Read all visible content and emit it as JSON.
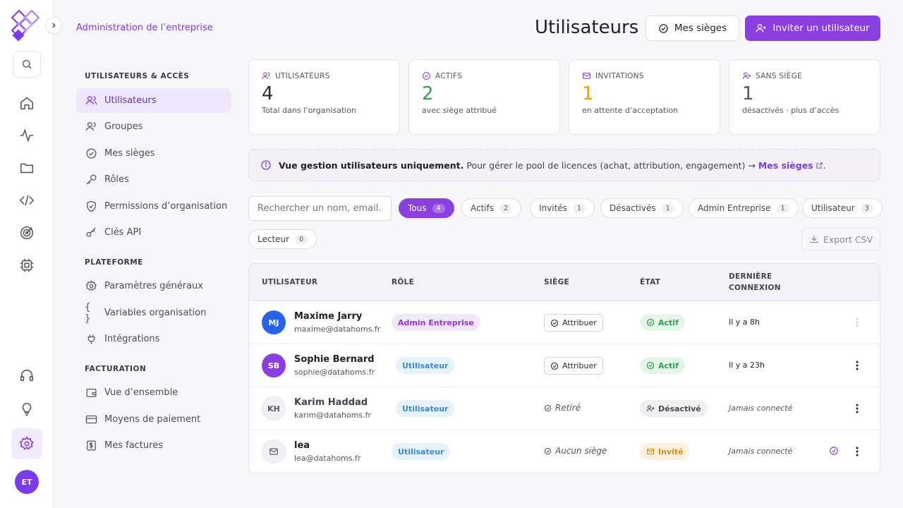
{
  "app": {
    "breadcrumb": "Administration de l’entreprise",
    "page_title": "Utilisateurs",
    "user_initials": "ET"
  },
  "rail": {
    "icons": [
      "search-icon",
      "home-icon",
      "activity-icon",
      "folder-icon",
      "code-icon",
      "target-icon",
      "chip-icon",
      "headphones-icon",
      "lightbulb-icon",
      "settings-icon"
    ]
  },
  "sidebar": {
    "sections": [
      {
        "title": "UTILISATEURS & ACCÈS",
        "items": [
          {
            "label": "Utilisateurs",
            "icon": "users-icon",
            "active": true
          },
          {
            "label": "Groupes",
            "icon": "group-icon"
          },
          {
            "label": "Mes sièges",
            "icon": "check-circle-icon"
          },
          {
            "label": "Rôles",
            "icon": "key-icon"
          },
          {
            "label": "Permissions d’organisation",
            "icon": "shield-icon"
          },
          {
            "label": "Clés API",
            "icon": "api-key-icon"
          }
        ]
      },
      {
        "title": "PLATEFORME",
        "items": [
          {
            "label": "Paramètres généraux",
            "icon": "gear-icon"
          },
          {
            "label": "Variables organisation",
            "icon": "braces-icon"
          },
          {
            "label": "Intégrations",
            "icon": "plug-icon"
          }
        ]
      },
      {
        "title": "FACTURATION",
        "items": [
          {
            "label": "Vue d’ensemble",
            "icon": "wallet-icon"
          },
          {
            "label": "Moyens de paiement",
            "icon": "credit-card-icon"
          },
          {
            "label": "Mes factures",
            "icon": "invoice-icon"
          }
        ]
      }
    ]
  },
  "header": {
    "seats_button": "Mes sièges",
    "invite_button": "Inviter un utilisateur"
  },
  "stats": [
    {
      "label": "UTILISATEURS",
      "value": "4",
      "sub": "Total dans l’organisation",
      "color": "#2b2b33",
      "icon": "users-icon",
      "icon_color": "#8b3fe0"
    },
    {
      "label": "ACTIFS",
      "value": "2",
      "sub": "avec siège attribué",
      "color": "#2f9e4f",
      "icon": "check-circle-icon",
      "icon_color": "#8b3fe0"
    },
    {
      "label": "INVITATIONS",
      "value": "1",
      "sub": "en attente d’acceptation",
      "color": "#f59e0b",
      "icon": "mail-icon",
      "icon_color": "#8b3fe0"
    },
    {
      "label": "SANS SIÈGE",
      "value": "1",
      "sub": "désactivés · plus d’accès",
      "color": "#55555f",
      "icon": "user-x-icon",
      "icon_color": "#8b3fe0"
    }
  ],
  "banner": {
    "bold": "Vue gestion utilisateurs uniquement.",
    "text": "Pour gérer le pool de licences (achat, attribution, engagement) →",
    "link": "Mes sièges",
    "tail": "."
  },
  "search": {
    "placeholder": "Rechercher un nom, email..."
  },
  "filters": [
    {
      "label": "Tous",
      "count": "4",
      "active": true
    },
    {
      "label": "Actifs",
      "count": "2"
    },
    {
      "label": "Invités",
      "count": "1"
    },
    {
      "label": "Désactivés",
      "count": "1"
    },
    {
      "label": "Admin Entreprise",
      "count": "1"
    },
    {
      "label": "Utilisateur",
      "count": "3"
    },
    {
      "label": "Lecteur",
      "count": "0"
    }
  ],
  "export_label": "Export CSV",
  "table": {
    "headers": {
      "user": "UTILISATEUR",
      "role": "RÔLE",
      "seat": "SIÈGE",
      "state": "ÉTAT",
      "last_1": "DERNIÈRE",
      "last_2": "CONNEXION"
    },
    "rows": [
      {
        "initials": "MJ",
        "name": "Maxime Jarry",
        "email": "maxime@datahoms.fr",
        "role": "Admin Entreprise",
        "role_type": "admin",
        "seat": "Attribuer",
        "seat_type": "button",
        "state": "Actif",
        "state_type": "active",
        "last": "Il y a 8h",
        "avatar_bg": "#2563eb",
        "avatar_fg": "#ffffff"
      },
      {
        "initials": "SB",
        "name": "Sophie Bernard",
        "email": "sophie@datahoms.fr",
        "role": "Utilisateur",
        "role_type": "user",
        "seat": "Attribuer",
        "seat_type": "button",
        "state": "Actif",
        "state_type": "active",
        "last": "Il y a 23h",
        "avatar_bg": "#8b3fe0",
        "avatar_fg": "#ffffff"
      },
      {
        "initials": "KH",
        "name": "Karim Haddad",
        "email": "karim@datahoms.fr",
        "role": "Utilisateur",
        "role_type": "user",
        "seat": "Retiré",
        "seat_type": "text",
        "state": "Désactivé",
        "state_type": "off",
        "last": "Jamais connecté",
        "avatar_bg": "#f1f1f4",
        "avatar_fg": "#55555f"
      },
      {
        "initials": "",
        "name": "lea",
        "email": "lea@datahoms.fr",
        "role": "Utilisateur",
        "role_type": "user",
        "seat": "Aucun siège",
        "seat_type": "text",
        "state": "Invité",
        "state_type": "inv",
        "last": "Jamais connecté",
        "avatar_bg": "#f1f1f4",
        "avatar_fg": "#55555f"
      }
    ]
  }
}
